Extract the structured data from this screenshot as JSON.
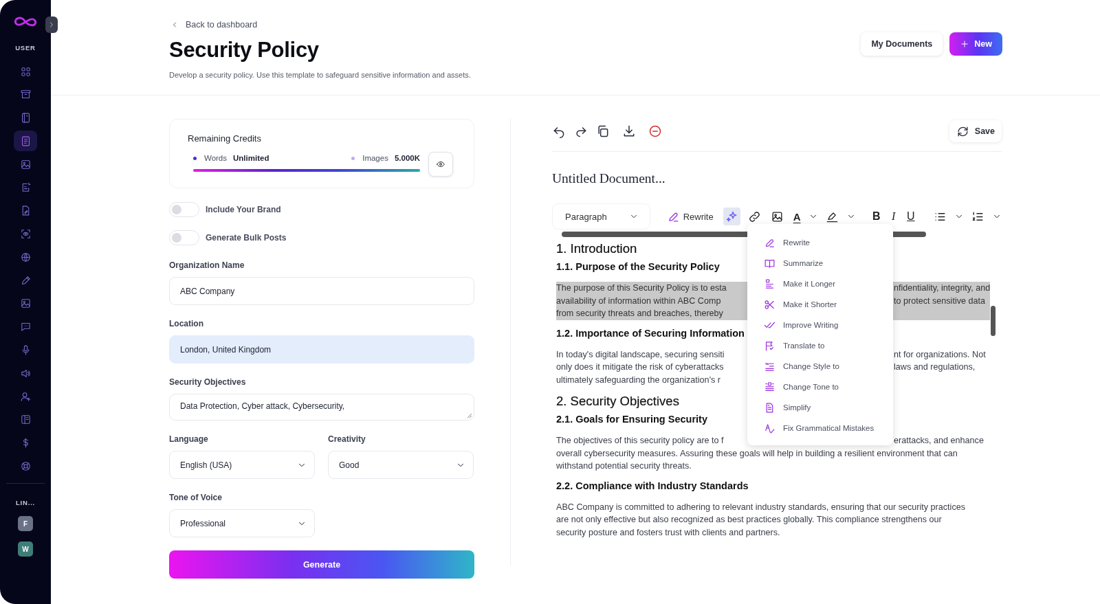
{
  "sidebar": {
    "section_label": "USER",
    "items": [
      {
        "selected": false
      },
      {
        "selected": false
      },
      {
        "selected": false
      },
      {
        "selected": true
      },
      {
        "selected": false
      },
      {
        "selected": false
      },
      {
        "selected": false
      },
      {
        "selected": false
      },
      {
        "selected": false
      },
      {
        "selected": false
      },
      {
        "selected": false
      },
      {
        "selected": false
      },
      {
        "selected": false
      },
      {
        "selected": false
      },
      {
        "selected": false
      },
      {
        "selected": false
      },
      {
        "selected": false
      },
      {
        "selected": false
      }
    ],
    "links_label": "LIN...",
    "avatars": [
      {
        "letter": "F",
        "color": "#6b7186"
      },
      {
        "letter": "W",
        "color": "#3f7d78"
      }
    ]
  },
  "header": {
    "back_link": "Back to dashboard",
    "title": "Security Policy",
    "subtitle": "Develop a security policy. Use this template to safeguard sensitive information and assets.",
    "buttons": [
      {
        "kind": "secondary",
        "label": "My Documents"
      },
      {
        "kind": "primary",
        "label": "New"
      }
    ]
  },
  "credits": {
    "title": "Remaining Credits",
    "stats": [
      {
        "label": "Words",
        "value": "Unlimited",
        "color": "#4a2fd6"
      },
      {
        "label": "Images",
        "value": "5.000K",
        "color": "#c4a8f0"
      }
    ],
    "level": 1
  },
  "toggles": [
    {
      "label": "Include Your Brand",
      "on": false
    },
    {
      "label": "Generate Bulk Posts",
      "on": false
    }
  ],
  "fields": [
    {
      "label": "Organization Name",
      "value": "ABC Company",
      "kind": "input",
      "highlighted": false
    },
    {
      "label": "Location",
      "value": "London, United Kingdom",
      "kind": "input",
      "highlighted": true
    },
    {
      "label": "Security Objectives",
      "value": "Data Protection, Cyber attack, Cybersecurity,",
      "kind": "textarea",
      "highlighted": false
    }
  ],
  "selects": [
    {
      "label": "Language",
      "value": "English (USA)"
    },
    {
      "label": "Creativity",
      "value": "Good"
    },
    {
      "label": "Tone of Voice",
      "value": "Professional"
    }
  ],
  "generate_button": "Generate",
  "editor": {
    "save_button": "Save",
    "document_title": "Untitled Document...",
    "format_toolbar": {
      "block_type": "Paragraph",
      "rewrite": "Rewrite",
      "ai_active": true,
      "text_color_glyph": "A",
      "bold": "B",
      "italic": "I",
      "underline": "U"
    },
    "blocks": [
      {
        "kind": "h1",
        "text": "1. Introduction"
      },
      {
        "kind": "h2",
        "text": "1.1. Purpose of the Security Policy"
      },
      {
        "kind": "p",
        "selected": true,
        "lines": [
          {
            "left": "The purpose of this Security Policy is to esta",
            "right": "nfidentiality, integrity, and"
          },
          {
            "left": "availability of information within ABC Comp",
            "right": "to protect sensitive data"
          },
          {
            "left": "from security threats and breaches, thereby"
          }
        ]
      },
      {
        "kind": "h2",
        "text": "1.2. Importance of Securing Information"
      },
      {
        "kind": "p",
        "selected": false,
        "lines": [
          {
            "left": "In today's digital landscape, securing sensiti",
            "right": "nt for organizations. Not"
          },
          {
            "left": "only does it mitigate the risk of cyberattacks",
            "right": "laws and regulations,"
          },
          {
            "left": "ultimately safeguarding the organization's r"
          }
        ]
      },
      {
        "kind": "h1",
        "text": "2. Security Objectives"
      },
      {
        "kind": "h2",
        "text": "2.1. Goals for Ensuring Security"
      },
      {
        "kind": "p",
        "selected": false,
        "lines": [
          {
            "left": "The objectives of this security policy are to f",
            "right": "erattacks, and enhance"
          },
          {
            "text": "overall cybersecurity measures. Assuring these goals will help in building a resilient environment that can"
          },
          {
            "text": "withstand potential security threats."
          }
        ]
      },
      {
        "kind": "h2",
        "text": "2.2. Compliance with Industry Standards"
      },
      {
        "kind": "p",
        "selected": false,
        "lines": [
          {
            "text": "ABC Company is committed to adhering to relevant industry standards, ensuring that our security practices"
          },
          {
            "text": "are not only effective but also recognized as best practices globally. This compliance strengthens our"
          },
          {
            "text": "security posture and fosters trust with clients and partners."
          }
        ]
      }
    ],
    "ai_menu": [
      "Rewrite",
      "Summarize",
      "Make it Longer",
      "Make it Shorter",
      "Improve Writing",
      "Translate to",
      "Change Style to",
      "Change Tone to",
      "Simplify",
      "Fix Grammatical Mistakes"
    ]
  }
}
